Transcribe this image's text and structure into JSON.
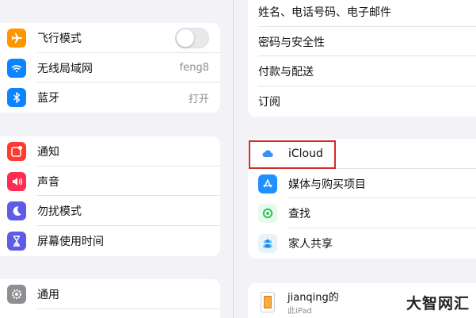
{
  "sidebar": {
    "group1": [
      {
        "label": "飞行模式",
        "icon": "airplane-icon",
        "color": "#ff9500"
      },
      {
        "label": "无线局域网",
        "value": "feng8",
        "icon": "wifi-icon",
        "color": "#0a84ff"
      },
      {
        "label": "蓝牙",
        "value": "打开",
        "icon": "bluetooth-icon",
        "color": "#0a84ff"
      }
    ],
    "group2": [
      {
        "label": "通知",
        "icon": "notification-icon",
        "color": "#ff3b30"
      },
      {
        "label": "声音",
        "icon": "sound-icon",
        "color": "#ff2d55"
      },
      {
        "label": "勿扰模式",
        "icon": "moon-icon",
        "color": "#5e5ce6"
      },
      {
        "label": "屏幕使用时间",
        "icon": "hourglass-icon",
        "color": "#5e5ce6"
      }
    ],
    "group3": [
      {
        "label": "通用",
        "icon": "gear-icon",
        "color": "#8e8e93"
      }
    ],
    "airplane_mode_on": false
  },
  "account": {
    "top_items": [
      {
        "label": "姓名、电话号码、电子邮件"
      },
      {
        "label": "密码与安全性"
      },
      {
        "label": "付款与配送"
      },
      {
        "label": "订阅"
      }
    ],
    "services": [
      {
        "label": "iCloud",
        "icon": "icloud-icon",
        "color": "#2f80ed"
      },
      {
        "label": "媒体与购买项目",
        "icon": "app-store-icon",
        "color": "#1e90ff"
      },
      {
        "label": "查找",
        "icon": "find-my-icon",
        "color": "#34c759"
      },
      {
        "label": "家人共享",
        "icon": "family-sharing-icon",
        "color": "#5ac8fa"
      }
    ],
    "device": {
      "name": "jianqing的",
      "model": "此iPad"
    }
  },
  "watermark": "大智网汇",
  "highlight_color": "#d42a2a"
}
